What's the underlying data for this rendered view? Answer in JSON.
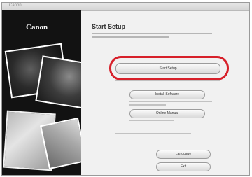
{
  "window": {
    "title": "Canon"
  },
  "left_panel": {
    "logo": "Canon"
  },
  "main": {
    "heading": "Start Setup"
  },
  "buttons": {
    "start_setup": "Start Setup",
    "install_software": "Install Software",
    "online_manual": "Online Manual",
    "language": "Language",
    "exit": "Exit"
  },
  "colors": {
    "highlight_ring": "#d7202a",
    "left_panel_bg": "#121212"
  }
}
